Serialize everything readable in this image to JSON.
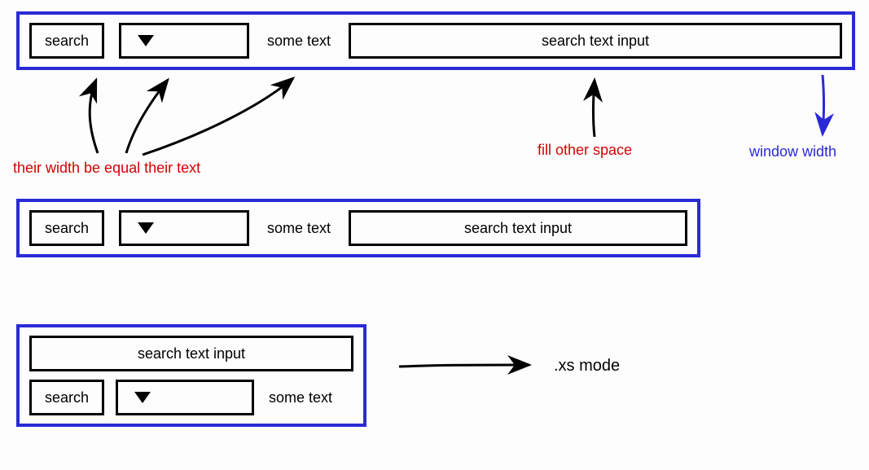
{
  "bar1": {
    "search_label": "search",
    "some_text": "some text",
    "input_label": "search text input"
  },
  "bar2": {
    "search_label": "search",
    "some_text": "some text",
    "input_label": "search text input"
  },
  "bar3": {
    "input_label": "search text input",
    "search_label": "search",
    "some_text": "some text"
  },
  "annotations": {
    "equal_text": "their width be equal their text",
    "fill_space": "fill other space",
    "window_width": "window width",
    "xs_mode": ".xs  mode"
  }
}
